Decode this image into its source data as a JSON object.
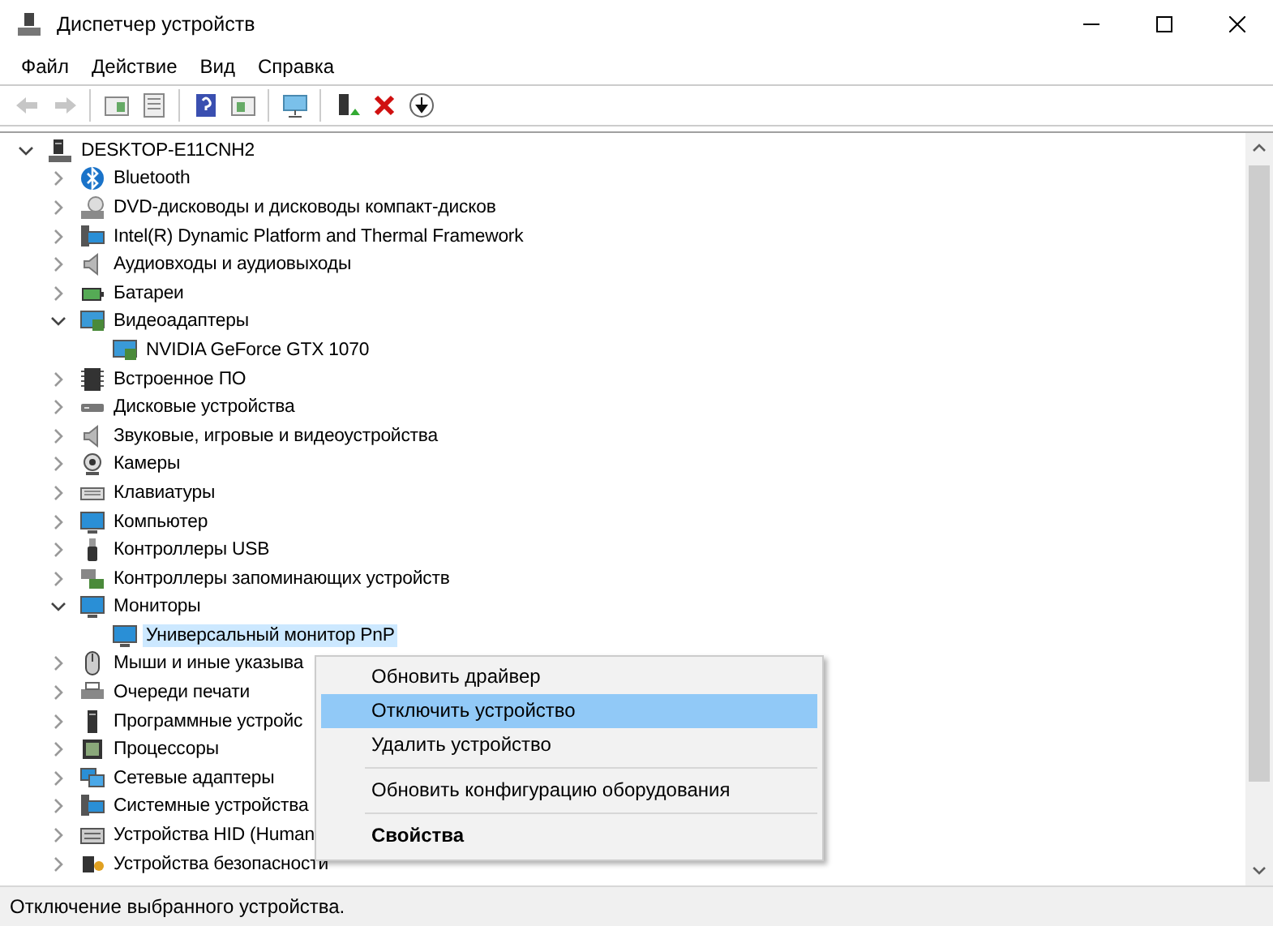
{
  "window": {
    "title": "Диспетчер устройств"
  },
  "menu": [
    "Файл",
    "Действие",
    "Вид",
    "Справка"
  ],
  "toolbar": [
    {
      "disabled": true
    },
    {
      "disabled": true
    },
    {
      "disabled": false
    },
    {
      "disabled": false
    },
    {
      "disabled": false
    },
    {
      "disabled": false
    },
    {
      "disabled": false
    },
    {
      "disabled": false
    },
    {
      "disabled": false
    },
    {
      "disabled": false
    }
  ],
  "tree": {
    "label": "DESKTOP-E11CNH2",
    "expanded": true,
    "selected": false,
    "children": [
      {
        "label": "Bluetooth",
        "expanded": false,
        "selected": false
      },
      {
        "label": "DVD-дисководы и дисководы компакт-дисков",
        "expanded": false,
        "selected": false
      },
      {
        "label": "Intel(R) Dynamic Platform and Thermal Framework",
        "expanded": false,
        "selected": false
      },
      {
        "label": "Аудиовходы и аудиовыходы",
        "expanded": false,
        "selected": false
      },
      {
        "label": "Батареи",
        "expanded": false,
        "selected": false
      },
      {
        "label": "Видеоадаптеры",
        "expanded": true,
        "selected": false,
        "children": [
          {
            "label": "NVIDIA GeForce GTX 1070",
            "selected": false
          }
        ]
      },
      {
        "label": "Встроенное ПО",
        "expanded": false,
        "selected": false
      },
      {
        "label": "Дисковые устройства",
        "expanded": false,
        "selected": false
      },
      {
        "label": "Звуковые, игровые и видеоустройства",
        "expanded": false,
        "selected": false
      },
      {
        "label": "Камеры",
        "expanded": false,
        "selected": false
      },
      {
        "label": "Клавиатуры",
        "expanded": false,
        "selected": false
      },
      {
        "label": "Компьютер",
        "expanded": false,
        "selected": false
      },
      {
        "label": "Контроллеры USB",
        "expanded": false,
        "selected": false
      },
      {
        "label": "Контроллеры запоминающих устройств",
        "expanded": false,
        "selected": false
      },
      {
        "label": "Мониторы",
        "expanded": true,
        "selected": false,
        "children": [
          {
            "label": "Универсальный монитор PnP",
            "selected": true
          }
        ]
      },
      {
        "label": "Мыши и иные указыва",
        "expanded": false,
        "selected": false
      },
      {
        "label": "Очереди печати",
        "expanded": false,
        "selected": false
      },
      {
        "label": "Программные устройс",
        "expanded": false,
        "selected": false
      },
      {
        "label": "Процессоры",
        "expanded": false,
        "selected": false
      },
      {
        "label": "Сетевые адаптеры",
        "expanded": false,
        "selected": false
      },
      {
        "label": "Системные устройства",
        "expanded": false,
        "selected": false
      },
      {
        "label": "Устройства HID (Human",
        "expanded": false,
        "selected": false
      },
      {
        "label": "Устройства безопасности",
        "expanded": false,
        "selected": false
      }
    ]
  },
  "context_menu": [
    {
      "kind": "item",
      "label": "Обновить драйвер",
      "selected": false,
      "default": false
    },
    {
      "kind": "item",
      "label": "Отключить устройство",
      "selected": true,
      "default": false
    },
    {
      "kind": "item",
      "label": "Удалить устройство",
      "selected": false,
      "default": false
    },
    {
      "kind": "separator"
    },
    {
      "kind": "item",
      "label": "Обновить конфигурацию оборудования",
      "selected": false,
      "default": false
    },
    {
      "kind": "separator"
    },
    {
      "kind": "item",
      "label": "Свойства",
      "selected": false,
      "default": true
    }
  ],
  "status_bar": "Отключение выбранного устройства."
}
